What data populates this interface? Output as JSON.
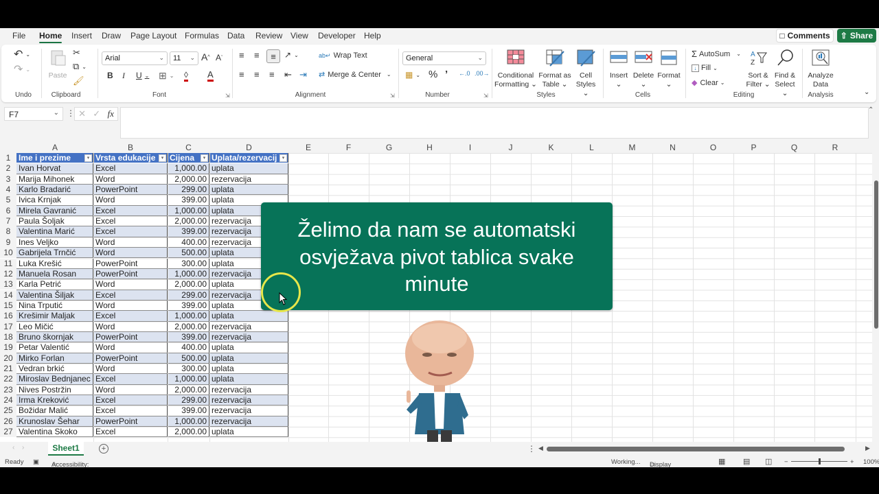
{
  "menu": {
    "tabs": [
      "File",
      "Home",
      "Insert",
      "Draw",
      "Page Layout",
      "Formulas",
      "Data",
      "Review",
      "View",
      "Developer",
      "Help"
    ],
    "active": "Home",
    "comments": "Comments",
    "share": "Share"
  },
  "ribbon": {
    "groups": {
      "undo": "Undo",
      "clipboard": "Clipboard",
      "font": "Font",
      "alignment": "Alignment",
      "number": "Number",
      "styles": "Styles",
      "cells": "Cells",
      "editing": "Editing",
      "analysis": "Analysis"
    },
    "paste": "Paste",
    "font_name": "Arial",
    "font_size": "11",
    "wrap_text": "Wrap Text",
    "merge_center": "Merge & Center",
    "number_format": "General",
    "conditional_formatting": [
      "Conditional",
      "Formatting"
    ],
    "format_as_table": [
      "Format as",
      "Table"
    ],
    "cell_styles": [
      "Cell",
      "Styles"
    ],
    "insert": "Insert",
    "delete": "Delete",
    "format": "Format",
    "autosum": "AutoSum",
    "fill": "Fill",
    "clear": "Clear",
    "sort_filter": [
      "Sort &",
      "Filter"
    ],
    "find_select": [
      "Find &",
      "Select"
    ],
    "analyze_data": [
      "Analyze",
      "Data"
    ],
    "accent": "#1d7a45"
  },
  "formula_bar": {
    "name_box": "F7",
    "fx": "fx",
    "value": ""
  },
  "grid": {
    "columns": [
      "A",
      "B",
      "C",
      "D",
      "E",
      "F",
      "G",
      "H",
      "I",
      "J",
      "K",
      "L",
      "M",
      "N",
      "O",
      "P",
      "Q",
      "R"
    ],
    "rows": [
      "1",
      "2",
      "3",
      "4",
      "5",
      "6",
      "7",
      "8",
      "9",
      "10",
      "11",
      "12",
      "13",
      "14",
      "15",
      "16",
      "17",
      "18",
      "19",
      "20",
      "21",
      "22",
      "23",
      "24",
      "25",
      "26",
      "27"
    ]
  },
  "table": {
    "headers": [
      "Ime i prezime",
      "Vrsta edukacije",
      "Cijena",
      "Uplata/rezervacij"
    ],
    "header_color": "#4472c4",
    "band_color": "#dce3f0",
    "rows": [
      [
        "Ivan Horvat",
        "Excel",
        "1,000.00",
        "uplata"
      ],
      [
        "Marija Mihonek",
        "Word",
        "2,000.00",
        "rezervacija"
      ],
      [
        "Karlo Bradarić",
        "PowerPoint",
        "299.00",
        "uplata"
      ],
      [
        "Ivica Krnjak",
        "Word",
        "399.00",
        "uplata"
      ],
      [
        "Mirela Gavranić",
        "Excel",
        "1,000.00",
        "uplata"
      ],
      [
        "Paula Šoljak",
        "Excel",
        "2,000.00",
        "rezervacija"
      ],
      [
        "Valentina Marić",
        "Excel",
        "399.00",
        "rezervacija"
      ],
      [
        "Ines Veljko",
        "Word",
        "400.00",
        "rezervacija"
      ],
      [
        "Gabrijela Trnčić",
        "Word",
        "500.00",
        "uplata"
      ],
      [
        "Luka Krešić",
        "PowerPoint",
        "300.00",
        "uplata"
      ],
      [
        "Manuela Rosan",
        "PowerPoint",
        "1,000.00",
        "rezervacija"
      ],
      [
        "Karla Petrić",
        "Word",
        "2,000.00",
        "uplata"
      ],
      [
        "Valentina Šiljak",
        "Excel",
        "299.00",
        "rezervacija"
      ],
      [
        "Nina Trputić",
        "Word",
        "399.00",
        "uplata"
      ],
      [
        "Krešimir Maljak",
        "Excel",
        "1,000.00",
        "uplata"
      ],
      [
        "Leo Mičić",
        "Word",
        "2,000.00",
        "rezervacija"
      ],
      [
        "Bruno škornjak",
        "PowerPoint",
        "399.00",
        "rezervacija"
      ],
      [
        "Petar Valentić",
        "Word",
        "400.00",
        "uplata"
      ],
      [
        "Mirko Forlan",
        "PowerPoint",
        "500.00",
        "uplata"
      ],
      [
        "Vedran brkić",
        "Word",
        "300.00",
        "uplata"
      ],
      [
        "Miroslav Bednjanec",
        "Excel",
        "1,000.00",
        "uplata"
      ],
      [
        "Nives Postržin",
        "Word",
        "2,000.00",
        "rezervacija"
      ],
      [
        "Irma Kreković",
        "Excel",
        "299.00",
        "rezervacija"
      ],
      [
        "Božidar Malić",
        "Excel",
        "399.00",
        "rezervacija"
      ],
      [
        "Krunoslav Šehar",
        "PowerPoint",
        "1,000.00",
        "rezervacija"
      ],
      [
        "Valentina Skoko",
        "Excel",
        "2,000.00",
        "uplata"
      ]
    ]
  },
  "callout": {
    "lines": [
      "Želimo da nam se automatski",
      "osvježava pivot tablica svake",
      "minute"
    ],
    "color": "#077358"
  },
  "sheets": {
    "tabs": [
      "Sheet1"
    ],
    "active": "Sheet1",
    "add": "+"
  },
  "status": {
    "ready": "Ready",
    "accessibility": "Accessibility: Good to go",
    "working": "Working...",
    "display_settings": "Display Settings",
    "zoom": "100%"
  }
}
